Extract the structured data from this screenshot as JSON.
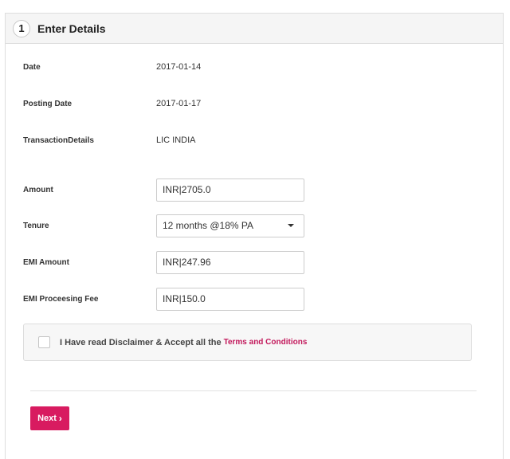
{
  "panel": {
    "step_number": "1",
    "title": "Enter Details"
  },
  "fields": {
    "date": {
      "label": "Date",
      "value": "2017-01-14"
    },
    "posting_date": {
      "label": "Posting Date",
      "value": "2017-01-17"
    },
    "transaction_details": {
      "label": "TransactionDetails",
      "value": "LIC INDIA"
    },
    "amount": {
      "label": "Amount",
      "value": "INR|2705.0"
    },
    "tenure": {
      "label": "Tenure",
      "selected": "12 months @18% PA"
    },
    "emi_amount": {
      "label": "EMI Amount",
      "value": "INR|247.96"
    },
    "emi_processing_fee": {
      "label": "EMI Proceesing Fee",
      "value": "INR|150.0"
    }
  },
  "terms": {
    "checked": false,
    "text": "I Have read Disclaimer & Accept all the",
    "link": "Terms and Conditions"
  },
  "actions": {
    "next_label": "Next",
    "next_icon": "chevron-right-icon"
  },
  "colors": {
    "accent": "#d81b60",
    "link": "#c2185b"
  }
}
